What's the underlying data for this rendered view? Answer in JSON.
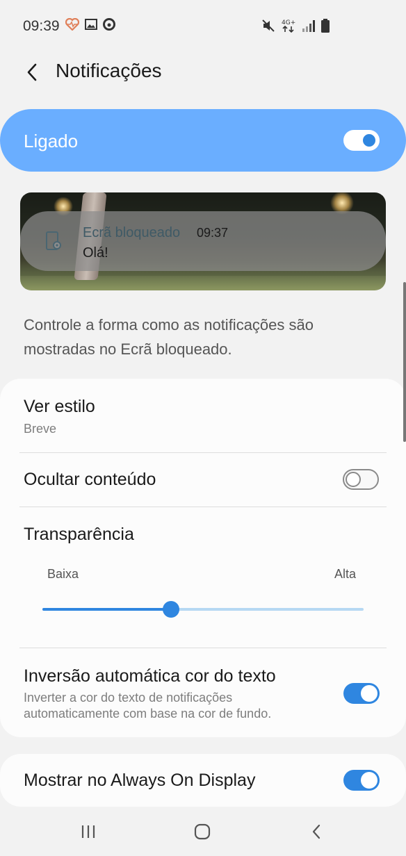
{
  "status_bar": {
    "time": "09:39",
    "left_icons": [
      "heart-rate-icon",
      "gallery-icon",
      "vodafone-icon"
    ],
    "right_icons": [
      "mute-icon",
      "4g-data-icon",
      "signal-icon",
      "battery-icon"
    ],
    "network_label": "4G+"
  },
  "header": {
    "title": "Notificações"
  },
  "master_switch": {
    "label": "Ligado",
    "state": "on"
  },
  "preview": {
    "app_name": "Ecrã bloqueado",
    "time": "09:37",
    "message": "Olá!"
  },
  "description": "Controle a forma como as notificações são mostradas no Ecrã bloqueado.",
  "settings": {
    "view_style": {
      "title": "Ver estilo",
      "value": "Breve"
    },
    "hide_content": {
      "title": "Ocultar conteúdo",
      "state": "off"
    },
    "transparency": {
      "title": "Transparência",
      "low_label": "Baixa",
      "high_label": "Alta",
      "level": 0.4
    },
    "auto_invert": {
      "title": "Inversão automática cor do texto",
      "subtitle": "Inverter a cor do texto de notificações automaticamente com base na cor de fundo.",
      "state": "on"
    },
    "always_on": {
      "title": "Mostrar no Always On Display",
      "state": "on"
    }
  },
  "colors": {
    "accent": "#2f86e0",
    "master_bar": "#6aaeff",
    "background": "#f2f2f2"
  },
  "nav_bar": {
    "buttons": [
      "recent-apps-icon",
      "home-icon",
      "back-icon"
    ]
  }
}
